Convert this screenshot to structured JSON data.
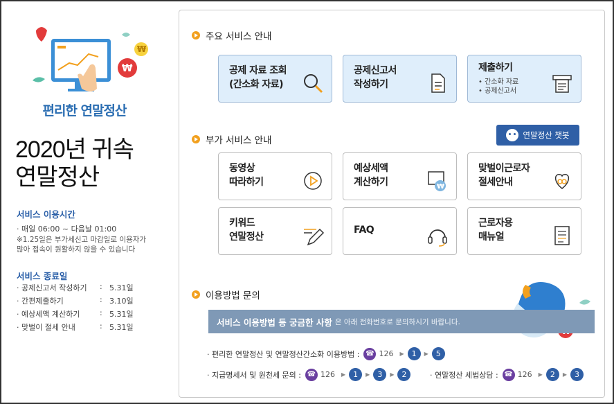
{
  "left": {
    "brand": "편리한 연말정산",
    "title": "2020년 귀속\n연말정산",
    "hours_heading": "서비스 이용시간",
    "hours_line": "· 매일 06:00 ~ 다음날 01:00",
    "hours_note": "※1.25일은 부가세신고 마감일로 이용자가\n   많아 접속이 원활하지 않을 수 있습니다",
    "end_heading": "서비스 종료일",
    "end_items": [
      {
        "name": "· 공제신고서 작성하기",
        "date": "5.31일"
      },
      {
        "name": "· 간편제출하기",
        "date": "3.10일"
      },
      {
        "name": "· 예상세액 계산하기",
        "date": "5.31일"
      },
      {
        "name": "· 맞벌이 절세 안내",
        "date": "5.31일"
      }
    ]
  },
  "main_services": {
    "title": "주요 서비스 안내",
    "cards": [
      {
        "label": "공제 자료 조회\n(간소화 자료)"
      },
      {
        "label": "공제신고서\n작성하기"
      },
      {
        "label": "제출하기",
        "sub": "• 간소화 자료\n• 공제신고서"
      }
    ]
  },
  "extra_services": {
    "title": "부가 서비스 안내",
    "chatbot": "연말정산 챗봇",
    "cards": [
      {
        "label": "동영상\n따라하기"
      },
      {
        "label": "예상세액\n계산하기"
      },
      {
        "label": "맞벌이근로자\n절세안내"
      },
      {
        "label": "키워드\n연말정산"
      },
      {
        "label": "FAQ"
      },
      {
        "label": "근로자용\n매뉴얼"
      }
    ]
  },
  "inquiry": {
    "title": "이용방법 문의",
    "banner_bold": "서비스 이용방법 등 궁금한 사항",
    "banner_rest": "은 아래 전화번호로 문의하시기 바랍니다.",
    "row1_label": "· 편리한 연말정산 및 연말정산간소화 이용방법 :",
    "row1_number": "126",
    "row1_steps": [
      "1",
      "5"
    ],
    "row2_label": "· 지급명세서 및 원천세 문의 :",
    "row2_number": "126",
    "row2_steps": [
      "1",
      "3",
      "2"
    ],
    "row3_label": "· 연말정산 세법상담 :",
    "row3_number": "126",
    "row3_steps": [
      "2",
      "3"
    ]
  },
  "colors": {
    "accent": "#2f5fa6",
    "card_blue": "#dfeefb",
    "bullet": "#f2a01e",
    "phone": "#6a3fa0",
    "banner": "#7f99b6"
  }
}
